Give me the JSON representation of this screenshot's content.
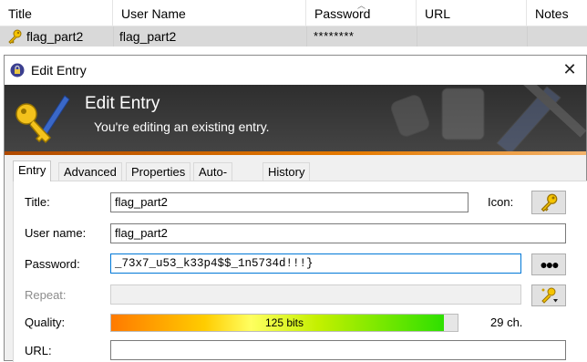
{
  "list": {
    "columns": [
      "Title",
      "User Name",
      "Password",
      "URL",
      "Notes"
    ],
    "row": {
      "title": "flag_part2",
      "username": "flag_part2",
      "password": "********"
    }
  },
  "dialog": {
    "window_title": "Edit Entry",
    "banner_title": "Edit Entry",
    "banner_subtitle": "You're editing an existing entry.",
    "tabs": [
      "Entry",
      "Advanced",
      "Properties",
      "Auto-Type",
      "History"
    ],
    "active_tab": "Entry",
    "labels": {
      "title": "Title:",
      "username": "User name:",
      "password": "Password:",
      "repeat": "Repeat:",
      "quality": "Quality:",
      "url": "URL:",
      "icon": "Icon:"
    },
    "fields": {
      "title": "flag_part2",
      "username": "flag_part2",
      "password": "_73x7_u53_k33p4$$_1n5734d!!!}",
      "repeat": "",
      "url": ""
    },
    "show_password_button": "●●●",
    "quality": {
      "value_label": "125 bits",
      "fraction": 0.96,
      "chars": "29 ch."
    },
    "colors": {
      "banner": "#333333",
      "accent_line": "#e57a00",
      "focus": "#0078d7"
    },
    "icons": [
      "key-icon",
      "lock-icon",
      "close-icon",
      "generate-password-icon"
    ]
  }
}
